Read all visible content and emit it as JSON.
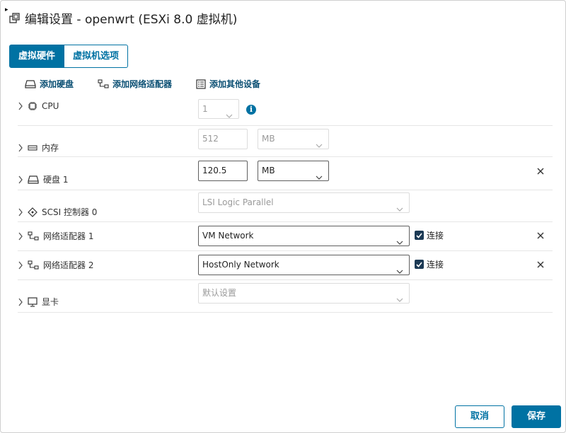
{
  "dialog": {
    "title": "编辑设置 - openwrt (ESXi 8.0 虚拟机)",
    "corner_mark": "▸"
  },
  "tabs": [
    {
      "label": "虚拟硬件",
      "active": true
    },
    {
      "label": "虚拟机选项",
      "active": false
    }
  ],
  "actions": {
    "add_disk": "添加硬盘",
    "add_network": "添加网络适配器",
    "add_other": "添加其他设备"
  },
  "devices": {
    "cpu": {
      "label": "CPU",
      "value": "1",
      "icon": "cpu-icon"
    },
    "memory": {
      "label": "内存",
      "value": "512",
      "unit": "MB",
      "icon": "memory-icon"
    },
    "disk": {
      "label": "硬盘 1",
      "value": "120.5",
      "unit": "MB",
      "icon": "disk-icon"
    },
    "scsi": {
      "label": "SCSI 控制器 0",
      "value": "LSI Logic Parallel",
      "icon": "scsi-controller-icon"
    },
    "nic1": {
      "label": "网络适配器 1",
      "value": "VM Network",
      "connect_label": "连接",
      "connected": true,
      "icon": "network-adapter-icon"
    },
    "nic2": {
      "label": "网络适配器 2",
      "value": "HostOnly Network",
      "connect_label": "连接",
      "connected": true,
      "icon": "network-adapter-icon"
    },
    "video": {
      "label": "显卡",
      "value": "默认设置",
      "icon": "monitor-icon"
    }
  },
  "footer": {
    "cancel": "取消",
    "save": "保存"
  },
  "colors": {
    "accent": "#0072a3",
    "check": "#1c3a55"
  }
}
